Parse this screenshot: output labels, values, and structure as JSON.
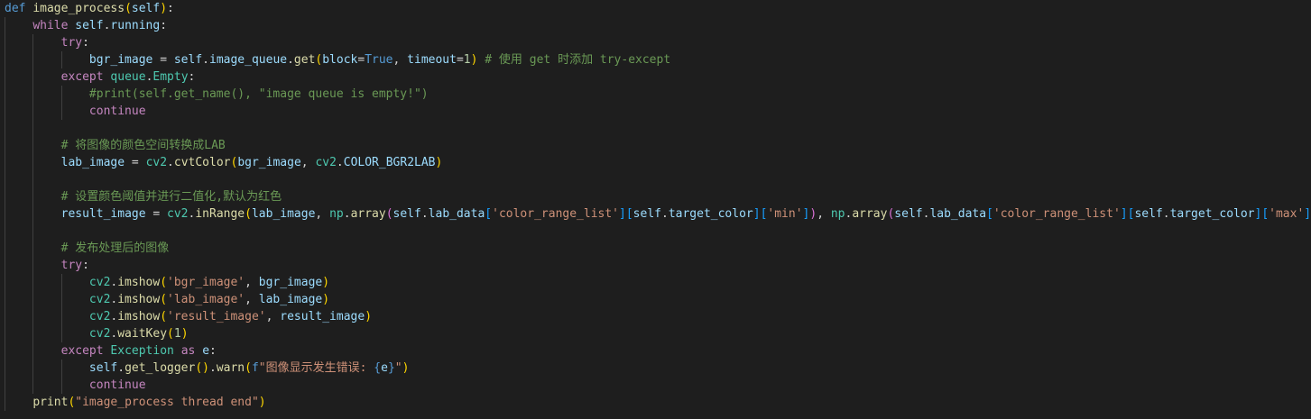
{
  "editor": {
    "lines": [
      {
        "indent": 0,
        "tokens": [
          {
            "t": "def",
            "c": "kw"
          },
          {
            "t": " ",
            "c": "pun"
          },
          {
            "t": "image_process",
            "c": "fn"
          },
          {
            "t": "(",
            "c": "br1"
          },
          {
            "t": "self",
            "c": "var"
          },
          {
            "t": ")",
            "c": "br1"
          },
          {
            "t": ":",
            "c": "pun"
          }
        ]
      },
      {
        "indent": 1,
        "tokens": [
          {
            "t": "while",
            "c": "ctl"
          },
          {
            "t": " ",
            "c": "pun"
          },
          {
            "t": "self",
            "c": "var"
          },
          {
            "t": ".",
            "c": "pun"
          },
          {
            "t": "running",
            "c": "var"
          },
          {
            "t": ":",
            "c": "pun"
          }
        ]
      },
      {
        "indent": 2,
        "tokens": [
          {
            "t": "try",
            "c": "ctl"
          },
          {
            "t": ":",
            "c": "pun"
          }
        ]
      },
      {
        "indent": 3,
        "tokens": [
          {
            "t": "bgr_image",
            "c": "var"
          },
          {
            "t": " = ",
            "c": "pun"
          },
          {
            "t": "self",
            "c": "var"
          },
          {
            "t": ".",
            "c": "pun"
          },
          {
            "t": "image_queue",
            "c": "var"
          },
          {
            "t": ".",
            "c": "pun"
          },
          {
            "t": "get",
            "c": "fn"
          },
          {
            "t": "(",
            "c": "br1"
          },
          {
            "t": "block",
            "c": "var"
          },
          {
            "t": "=",
            "c": "pun"
          },
          {
            "t": "True",
            "c": "kw"
          },
          {
            "t": ", ",
            "c": "pun"
          },
          {
            "t": "timeout",
            "c": "var"
          },
          {
            "t": "=",
            "c": "pun"
          },
          {
            "t": "1",
            "c": "num"
          },
          {
            "t": ")",
            "c": "br1"
          },
          {
            "t": " # 使用 get 时添加 try-except",
            "c": "com"
          }
        ]
      },
      {
        "indent": 2,
        "tokens": [
          {
            "t": "except",
            "c": "ctl"
          },
          {
            "t": " ",
            "c": "pun"
          },
          {
            "t": "queue",
            "c": "cls"
          },
          {
            "t": ".",
            "c": "pun"
          },
          {
            "t": "Empty",
            "c": "cls"
          },
          {
            "t": ":",
            "c": "pun"
          }
        ]
      },
      {
        "indent": 3,
        "tokens": [
          {
            "t": "#print(self.get_name(), \"image queue is empty!\")",
            "c": "com"
          }
        ]
      },
      {
        "indent": 3,
        "tokens": [
          {
            "t": "continue",
            "c": "ctl"
          }
        ]
      },
      {
        "indent": 2,
        "tokens": []
      },
      {
        "indent": 2,
        "tokens": [
          {
            "t": "# 将图像的颜色空间转换成LAB",
            "c": "com"
          }
        ]
      },
      {
        "indent": 2,
        "tokens": [
          {
            "t": "lab_image",
            "c": "var"
          },
          {
            "t": " = ",
            "c": "pun"
          },
          {
            "t": "cv2",
            "c": "cls"
          },
          {
            "t": ".",
            "c": "pun"
          },
          {
            "t": "cvtColor",
            "c": "fn"
          },
          {
            "t": "(",
            "c": "br1"
          },
          {
            "t": "bgr_image",
            "c": "var"
          },
          {
            "t": ", ",
            "c": "pun"
          },
          {
            "t": "cv2",
            "c": "cls"
          },
          {
            "t": ".",
            "c": "pun"
          },
          {
            "t": "COLOR_BGR2LAB",
            "c": "var"
          },
          {
            "t": ")",
            "c": "br1"
          }
        ]
      },
      {
        "indent": 2,
        "tokens": []
      },
      {
        "indent": 2,
        "tokens": [
          {
            "t": "# 设置颜色阈值并进行二值化,默认为红色",
            "c": "com"
          }
        ]
      },
      {
        "indent": 2,
        "tokens": [
          {
            "t": "result_image",
            "c": "var"
          },
          {
            "t": " = ",
            "c": "pun"
          },
          {
            "t": "cv2",
            "c": "cls"
          },
          {
            "t": ".",
            "c": "pun"
          },
          {
            "t": "inRange",
            "c": "fn"
          },
          {
            "t": "(",
            "c": "br1"
          },
          {
            "t": "lab_image",
            "c": "var"
          },
          {
            "t": ", ",
            "c": "pun"
          },
          {
            "t": "np",
            "c": "cls"
          },
          {
            "t": ".",
            "c": "pun"
          },
          {
            "t": "array",
            "c": "fn"
          },
          {
            "t": "(",
            "c": "br2"
          },
          {
            "t": "self",
            "c": "var"
          },
          {
            "t": ".",
            "c": "pun"
          },
          {
            "t": "lab_data",
            "c": "var"
          },
          {
            "t": "[",
            "c": "br3"
          },
          {
            "t": "'color_range_list'",
            "c": "str"
          },
          {
            "t": "]",
            "c": "br3"
          },
          {
            "t": "[",
            "c": "br3"
          },
          {
            "t": "self",
            "c": "var"
          },
          {
            "t": ".",
            "c": "pun"
          },
          {
            "t": "target_color",
            "c": "var"
          },
          {
            "t": "]",
            "c": "br3"
          },
          {
            "t": "[",
            "c": "br3"
          },
          {
            "t": "'min'",
            "c": "str"
          },
          {
            "t": "]",
            "c": "br3"
          },
          {
            "t": ")",
            "c": "br2"
          },
          {
            "t": ", ",
            "c": "pun"
          },
          {
            "t": "np",
            "c": "cls"
          },
          {
            "t": ".",
            "c": "pun"
          },
          {
            "t": "array",
            "c": "fn"
          },
          {
            "t": "(",
            "c": "br2"
          },
          {
            "t": "self",
            "c": "var"
          },
          {
            "t": ".",
            "c": "pun"
          },
          {
            "t": "lab_data",
            "c": "var"
          },
          {
            "t": "[",
            "c": "br3"
          },
          {
            "t": "'color_range_list'",
            "c": "str"
          },
          {
            "t": "]",
            "c": "br3"
          },
          {
            "t": "[",
            "c": "br3"
          },
          {
            "t": "self",
            "c": "var"
          },
          {
            "t": ".",
            "c": "pun"
          },
          {
            "t": "target_color",
            "c": "var"
          },
          {
            "t": "]",
            "c": "br3"
          },
          {
            "t": "[",
            "c": "br3"
          },
          {
            "t": "'max'",
            "c": "str"
          },
          {
            "t": "]",
            "c": "br3"
          },
          {
            "t": ")",
            "c": "br2"
          },
          {
            "t": ")",
            "c": "br1"
          }
        ]
      },
      {
        "indent": 2,
        "tokens": []
      },
      {
        "indent": 2,
        "tokens": [
          {
            "t": "# 发布处理后的图像",
            "c": "com"
          }
        ]
      },
      {
        "indent": 2,
        "tokens": [
          {
            "t": "try",
            "c": "ctl"
          },
          {
            "t": ":",
            "c": "pun"
          }
        ]
      },
      {
        "indent": 3,
        "tokens": [
          {
            "t": "cv2",
            "c": "cls"
          },
          {
            "t": ".",
            "c": "pun"
          },
          {
            "t": "imshow",
            "c": "fn"
          },
          {
            "t": "(",
            "c": "br1"
          },
          {
            "t": "'bgr_image'",
            "c": "str"
          },
          {
            "t": ", ",
            "c": "pun"
          },
          {
            "t": "bgr_image",
            "c": "var"
          },
          {
            "t": ")",
            "c": "br1"
          }
        ]
      },
      {
        "indent": 3,
        "tokens": [
          {
            "t": "cv2",
            "c": "cls"
          },
          {
            "t": ".",
            "c": "pun"
          },
          {
            "t": "imshow",
            "c": "fn"
          },
          {
            "t": "(",
            "c": "br1"
          },
          {
            "t": "'lab_image'",
            "c": "str"
          },
          {
            "t": ", ",
            "c": "pun"
          },
          {
            "t": "lab_image",
            "c": "var"
          },
          {
            "t": ")",
            "c": "br1"
          }
        ]
      },
      {
        "indent": 3,
        "tokens": [
          {
            "t": "cv2",
            "c": "cls"
          },
          {
            "t": ".",
            "c": "pun"
          },
          {
            "t": "imshow",
            "c": "fn"
          },
          {
            "t": "(",
            "c": "br1"
          },
          {
            "t": "'result_image'",
            "c": "str"
          },
          {
            "t": ", ",
            "c": "pun"
          },
          {
            "t": "result_image",
            "c": "var"
          },
          {
            "t": ")",
            "c": "br1"
          }
        ]
      },
      {
        "indent": 3,
        "tokens": [
          {
            "t": "cv2",
            "c": "cls"
          },
          {
            "t": ".",
            "c": "pun"
          },
          {
            "t": "waitKey",
            "c": "fn"
          },
          {
            "t": "(",
            "c": "br1"
          },
          {
            "t": "1",
            "c": "num"
          },
          {
            "t": ")",
            "c": "br1"
          }
        ]
      },
      {
        "indent": 2,
        "tokens": [
          {
            "t": "except",
            "c": "ctl"
          },
          {
            "t": " ",
            "c": "pun"
          },
          {
            "t": "Exception",
            "c": "cls"
          },
          {
            "t": " ",
            "c": "pun"
          },
          {
            "t": "as",
            "c": "ctl"
          },
          {
            "t": " ",
            "c": "pun"
          },
          {
            "t": "e",
            "c": "var"
          },
          {
            "t": ":",
            "c": "pun"
          }
        ]
      },
      {
        "indent": 3,
        "tokens": [
          {
            "t": "self",
            "c": "var"
          },
          {
            "t": ".",
            "c": "pun"
          },
          {
            "t": "get_logger",
            "c": "fn"
          },
          {
            "t": "(",
            "c": "br1"
          },
          {
            "t": ")",
            "c": "br1"
          },
          {
            "t": ".",
            "c": "pun"
          },
          {
            "t": "warn",
            "c": "fn"
          },
          {
            "t": "(",
            "c": "br1"
          },
          {
            "t": "f",
            "c": "kw"
          },
          {
            "t": "\"图像显示发生错误: ",
            "c": "str"
          },
          {
            "t": "{",
            "c": "kw"
          },
          {
            "t": "e",
            "c": "var"
          },
          {
            "t": "}",
            "c": "kw"
          },
          {
            "t": "\"",
            "c": "str"
          },
          {
            "t": ")",
            "c": "br1"
          }
        ]
      },
      {
        "indent": 3,
        "tokens": [
          {
            "t": "continue",
            "c": "ctl"
          }
        ]
      },
      {
        "indent": 1,
        "tokens": [
          {
            "t": "print",
            "c": "fn"
          },
          {
            "t": "(",
            "c": "br1"
          },
          {
            "t": "\"image_process thread end\"",
            "c": "str"
          },
          {
            "t": ")",
            "c": "br1"
          }
        ]
      }
    ]
  }
}
